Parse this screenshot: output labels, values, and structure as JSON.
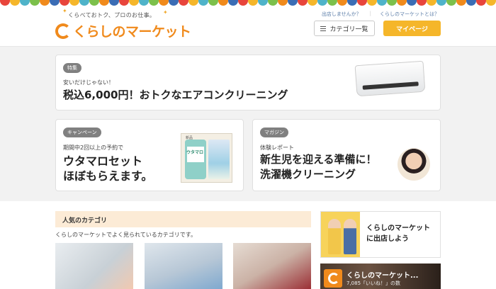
{
  "header": {
    "tagline": "くらべておトク、プロのお仕事。",
    "logo_text": "くらしのマーケット",
    "links": [
      "出店しませんか？",
      "くらしのマーケットとは？"
    ],
    "category_button": "カテゴリ一覧",
    "mypage_button": "マイページ"
  },
  "bunting_colors": [
    "#e8453c",
    "#f5b62a",
    "#4fb3c9",
    "#7cc04b",
    "#f08a1c",
    "#3b6db5"
  ],
  "feature": {
    "badge": "特集",
    "lead": "安いだけじゃない！",
    "title": "税込6,000円！おトクなエアコンクリーニング"
  },
  "campaign": {
    "badge": "キャンペーン",
    "lead": "期間中2回以上の予約で",
    "title_line1": "ウタマロセット",
    "title_line2": "ほぼもらえます。",
    "product_label": "ウタマロ",
    "product_top": "新品"
  },
  "magazine": {
    "badge": "マガジン",
    "lead": "体験レポート",
    "title_line1": "新生児を迎える準備に！",
    "title_line2": "洗濯機クリーニング"
  },
  "popular": {
    "heading": "人気のカテゴリ",
    "description": "くらしのマーケットでよく見られているカテゴリです。"
  },
  "side_banner": {
    "text_line1": "くらしのマーケット",
    "text_line2": "に出店しよう"
  },
  "fb_banner": {
    "title": "くらしのマーケット...",
    "sub": "7,085「いいね！」の数"
  }
}
